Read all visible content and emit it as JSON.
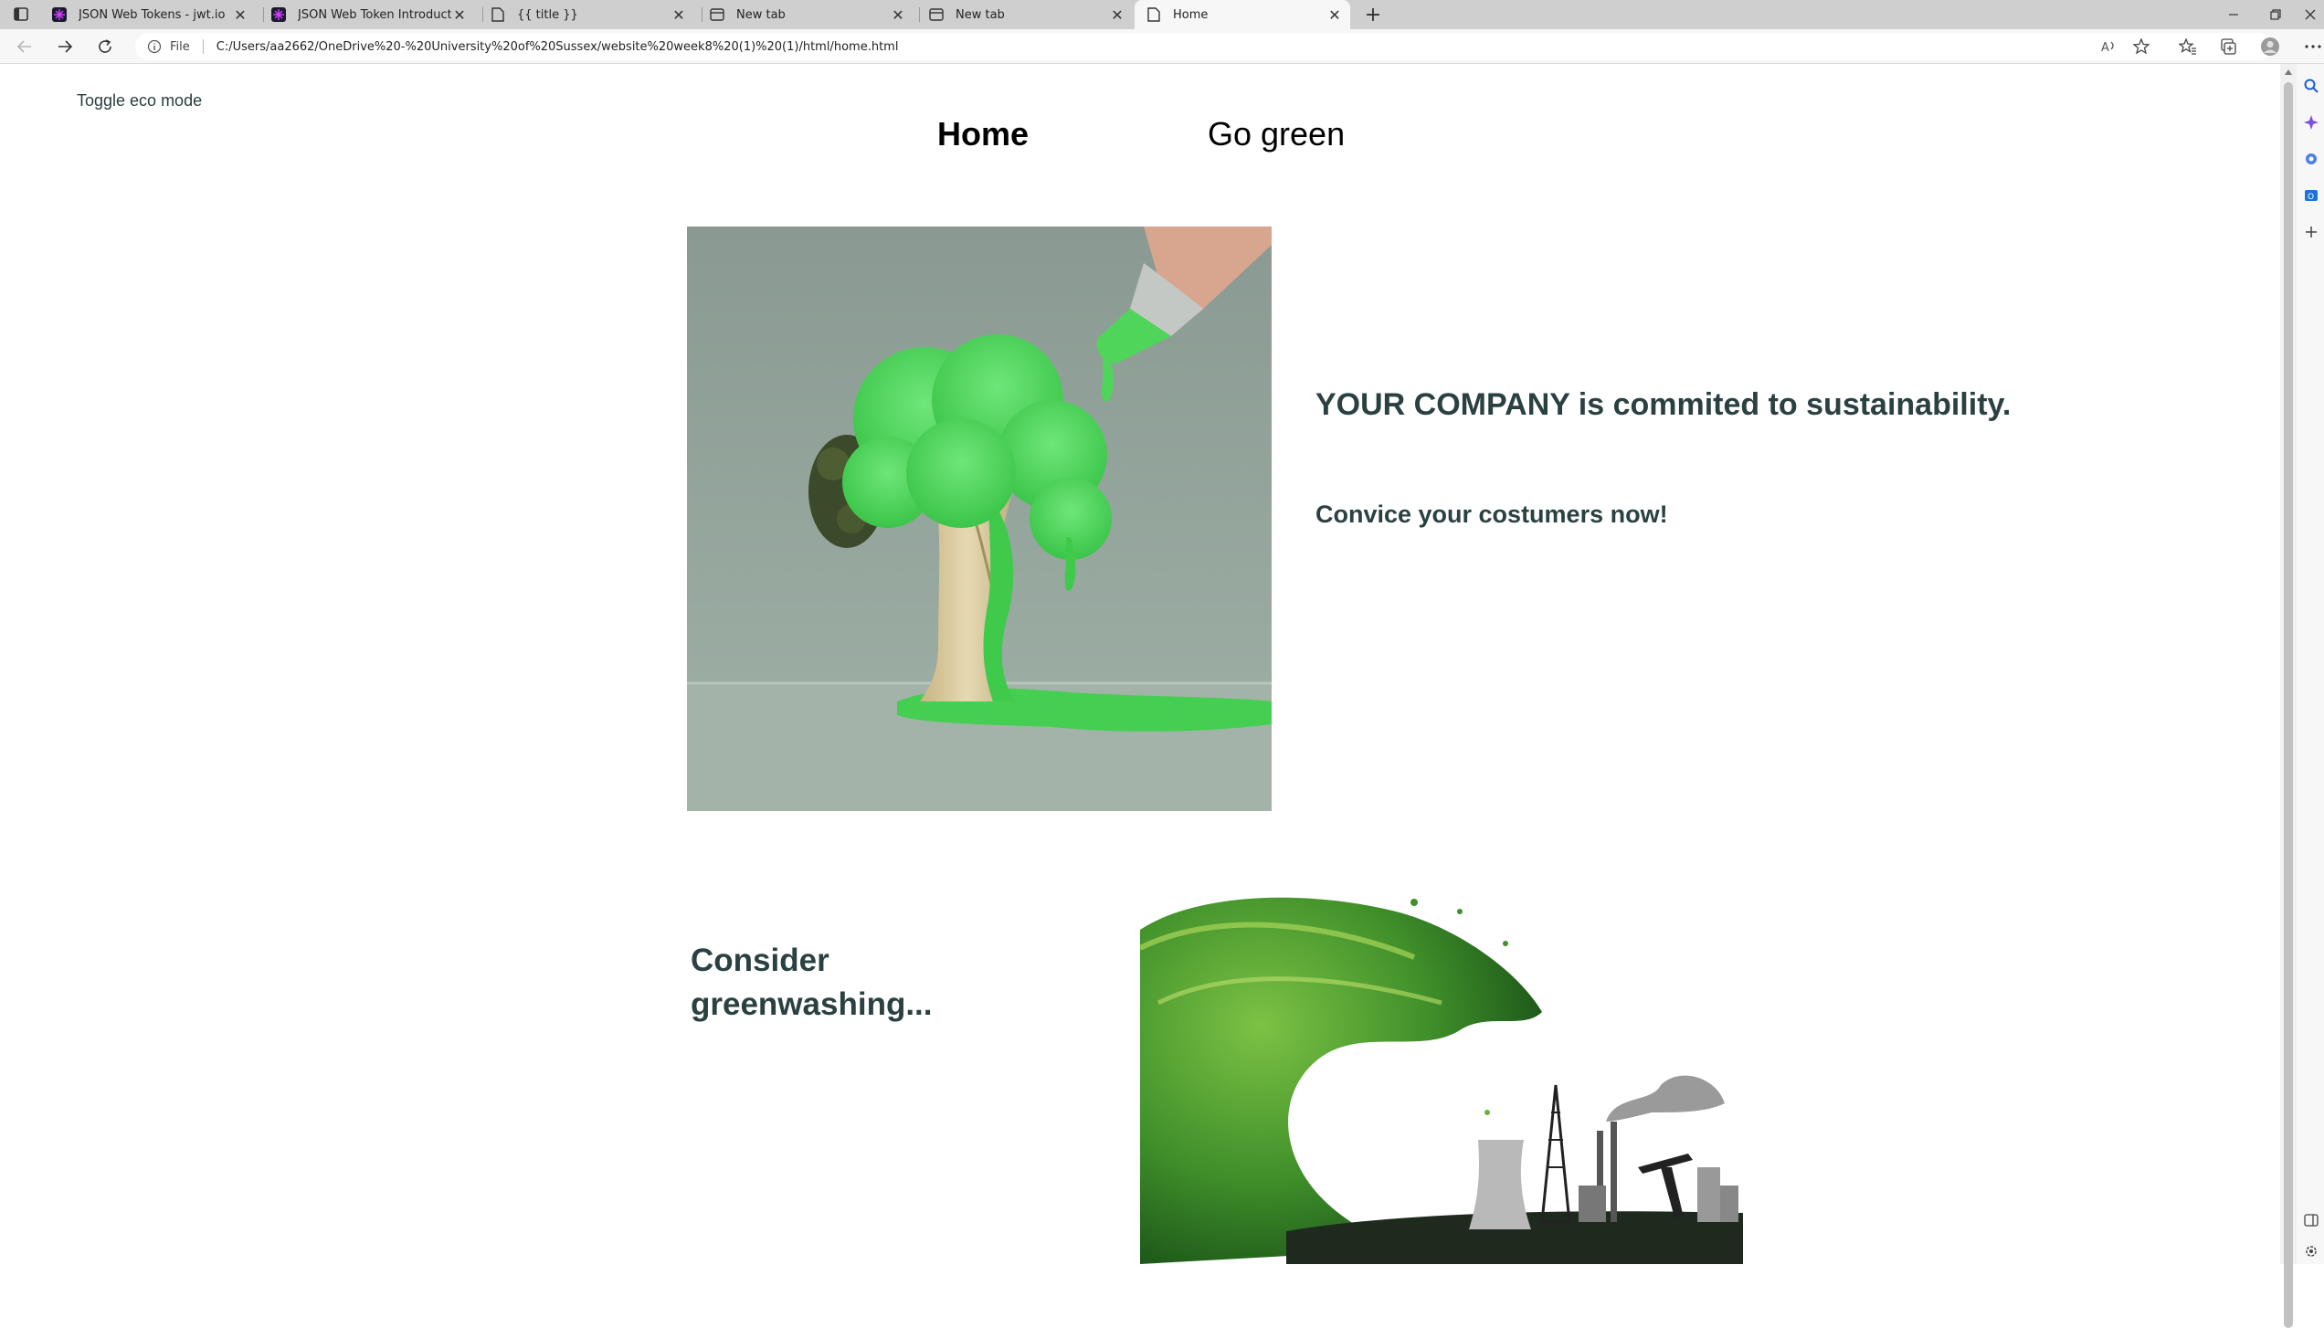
{
  "browser": {
    "tabs": [
      {
        "title": "JSON Web Tokens - jwt.io",
        "favicon": "jwt-icon",
        "active": false
      },
      {
        "title": "JSON Web Token Introduction - jwt.io",
        "favicon": "jwt-icon",
        "active": false
      },
      {
        "title": "{{ title }}",
        "favicon": "page-icon",
        "active": false
      },
      {
        "title": "New tab",
        "favicon": "newtab-icon",
        "active": false
      },
      {
        "title": "New tab",
        "favicon": "newtab-icon",
        "active": false
      },
      {
        "title": "Home",
        "favicon": "page-icon",
        "active": true
      }
    ],
    "address_bar": {
      "scheme_label": "File",
      "url": "C:/Users/aa2662/OneDrive%20-%20University%20of%20Sussex/website%20week8%20(1)%20(1)/html/home.html"
    }
  },
  "page": {
    "eco_toggle_label": "Toggle eco mode",
    "nav": {
      "home_label": "Home",
      "go_green_label": "Go green"
    },
    "hero": {
      "headline": "YOUR COMPANY is commited to sustainability.",
      "subline": "Convice your costumers now!"
    },
    "greenwashing": {
      "heading": "Consider greenwashing..."
    }
  },
  "colors": {
    "heading_text": "#2b4141",
    "paint_green": "#4fd65a",
    "image_background": "#97a89e"
  }
}
